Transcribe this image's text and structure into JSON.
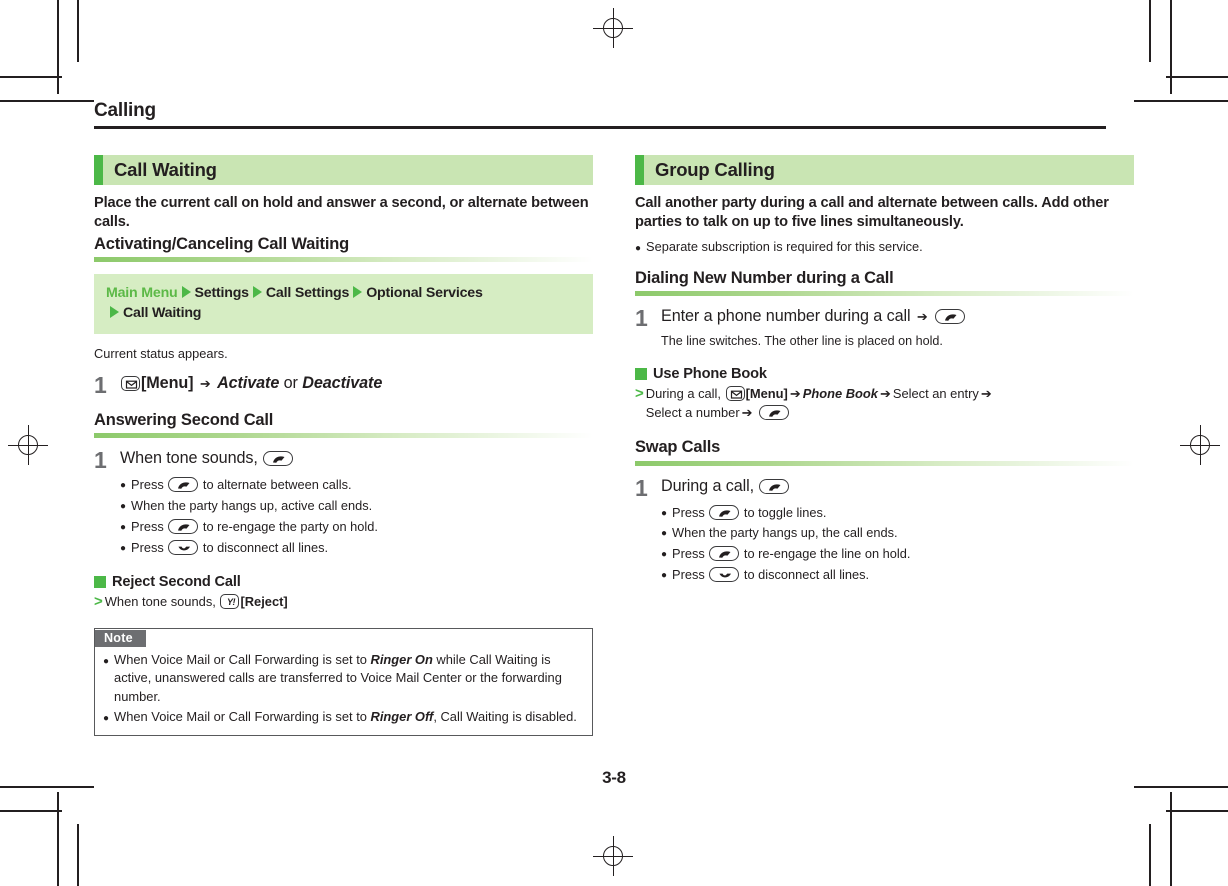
{
  "page": {
    "running_head": "Calling",
    "folio": "3-8"
  },
  "colors": {
    "accent_green": "#4cb847",
    "banner_bg": "#c9e5b3",
    "path_bg": "#d6edc3",
    "note_tab": "#6d6e71",
    "step_number": "#6d6e71",
    "text": "#231f20"
  },
  "left_column": {
    "banner": "Call Waiting",
    "lead": "Place the current call on hold and answer a second, or alternate between calls.",
    "subhead_1": "Activating/Canceling Call Waiting",
    "menu_path": {
      "items": [
        "Main Menu",
        "Settings",
        "Call Settings",
        "Optional Services",
        "Call Waiting"
      ]
    },
    "status_note": "Current status appears.",
    "step_1": {
      "number": "1",
      "key_icon": "menu-key-icon",
      "key_label": "[Menu]",
      "arrow": "➔",
      "option_a": "Activate",
      "conjunction": "or",
      "option_b": "Deactivate"
    },
    "subhead_2": "Answering Second Call",
    "step_2": {
      "number": "1",
      "title": "When tone sounds,",
      "title_key": "send-key-icon",
      "bullets": [
        {
          "pre": "Press",
          "key": "send-key-icon",
          "post": "to alternate between calls."
        },
        {
          "pre": "",
          "key": "",
          "post": "When the party hangs up, active call ends."
        },
        {
          "pre": "Press",
          "key": "send-key-icon",
          "post": "to re-engage the party on hold."
        },
        {
          "pre": "Press",
          "key": "end-key-icon",
          "post": "to disconnect all lines."
        }
      ]
    },
    "reject": {
      "heading": "Reject Second Call",
      "line_pre": "When tone sounds,",
      "key_icon": "yahoo-key-icon",
      "line_post": "[Reject]"
    },
    "note": {
      "label": "Note",
      "items": [
        {
          "part1": "When Voice Mail or Call Forwarding is set to ",
          "emph": "Ringer On",
          "part2": " while Call Waiting is active, unanswered calls are transferred to Voice Mail Center or the forwarding number."
        },
        {
          "part1": "When Voice Mail or Call Forwarding is set to ",
          "emph": "Ringer Off",
          "part2": ", Call Waiting is disabled."
        }
      ]
    }
  },
  "right_column": {
    "banner": "Group Calling",
    "lead": "Call another party during a call and alternate between calls. Add other parties to talk on up to five lines simultaneously.",
    "lead_bullet": "Separate subscription is required for this service.",
    "subhead_1": "Dialing New Number during a Call",
    "step_1": {
      "number": "1",
      "title": "Enter a phone number during a call",
      "arrow": "➔",
      "title_key": "send-key-icon",
      "desc": "The line switches. The other line is placed on hold."
    },
    "phone_book": {
      "heading": "Use Phone Book",
      "seg1": "During a call,",
      "key1": "menu-key-icon",
      "seg2": "[Menu]",
      "arrow1": "➔",
      "seg3": "Phone Book",
      "arrow2": "➔",
      "seg4": "Select an entry",
      "arrow3": "➔",
      "seg5": "Select a number",
      "arrow4": "➔",
      "key2": "send-key-icon"
    },
    "subhead_2": "Swap Calls",
    "step_2": {
      "number": "1",
      "title": "During a call,",
      "title_key": "send-key-icon",
      "bullets": [
        {
          "pre": "Press",
          "key": "send-key-icon",
          "post": "to toggle lines."
        },
        {
          "pre": "",
          "key": "",
          "post": "When the party hangs up, the call ends."
        },
        {
          "pre": "Press",
          "key": "send-key-icon",
          "post": "to re-engage the line on hold."
        },
        {
          "pre": "Press",
          "key": "end-key-icon",
          "post": "to disconnect all lines."
        }
      ]
    }
  }
}
